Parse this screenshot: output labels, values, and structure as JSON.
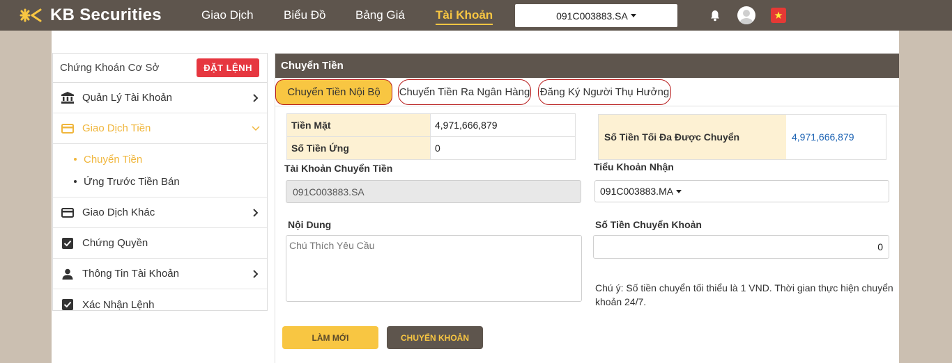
{
  "brand": {
    "name": "KB Securities"
  },
  "nav": {
    "items": [
      {
        "label": "Giao Dịch",
        "active": false
      },
      {
        "label": "Biểu Đồ",
        "active": false
      },
      {
        "label": "Bảng Giá",
        "active": false
      },
      {
        "label": "Tài Khoản",
        "active": true
      }
    ],
    "account": "091C003883.SA"
  },
  "icons": {
    "notification": "bell-icon",
    "user": "user-avatar-icon",
    "language": "vietnam-flag-icon"
  },
  "sidebar": {
    "title": "Chứng Khoán Cơ Sở",
    "order_button": "ĐẶT LỆNH",
    "items": [
      {
        "label": "Quản Lý Tài Khoản",
        "icon": "bank-icon",
        "chevron": "chevron-right-icon"
      },
      {
        "label": "Giao Dịch Tiền",
        "icon": "card-icon",
        "chevron": "chevron-down-icon",
        "active": true
      },
      {
        "label": "Giao Dịch Khác",
        "icon": "card-icon",
        "chevron": "chevron-right-icon"
      },
      {
        "label": "Chứng Quyền",
        "icon": "checkbox-icon"
      },
      {
        "label": "Thông Tin Tài Khoản",
        "icon": "person-icon",
        "chevron": "chevron-right-icon"
      },
      {
        "label": "Xác Nhận Lệnh",
        "icon": "checkbox-icon"
      }
    ],
    "sub_items": [
      {
        "label": "Chuyển Tiền",
        "active": true
      },
      {
        "label": "Ứng Trước Tiền Bán",
        "active": false
      }
    ]
  },
  "panel": {
    "title": "Chuyển Tiền",
    "tabs": [
      {
        "label": "Chuyển Tiền Nội Bộ",
        "active": true
      },
      {
        "label": "Chuyển Tiền Ra Ngân Hàng",
        "active": false
      },
      {
        "label": "Đăng Ký Người Thụ Hưởng",
        "active": false
      }
    ],
    "balances": [
      {
        "label": "Tiền Mặt",
        "value": "4,971,666,879"
      },
      {
        "label": "Số Tiền Ứng",
        "value": "0"
      }
    ],
    "max_transfer": {
      "label": "Số Tiền Tối Đa Được Chuyển",
      "value": "4,971,666,879"
    },
    "from_account": {
      "label": "Tài Khoản Chuyển Tiền",
      "value": "091C003883.SA"
    },
    "to_account": {
      "label": "Tiểu Khoản Nhận",
      "value": "091C003883.MA"
    },
    "content": {
      "label": "Nội Dung",
      "placeholder": "Chú Thích Yêu Cầu"
    },
    "amount": {
      "label": "Số Tiền Chuyển Khoản",
      "value": "0"
    },
    "note": "Chú ý: Số tiền chuyển tối thiểu là 1 VND. Thời gian thực hiện chuyển khoản 24/7.",
    "buttons": {
      "reset": "LÀM MỚI",
      "submit": "CHUYỂN KHOẢN"
    }
  },
  "colors": {
    "header_bg": "#5e554d",
    "accent": "#f8c642",
    "danger": "#e63740",
    "link": "#1e64b4"
  }
}
